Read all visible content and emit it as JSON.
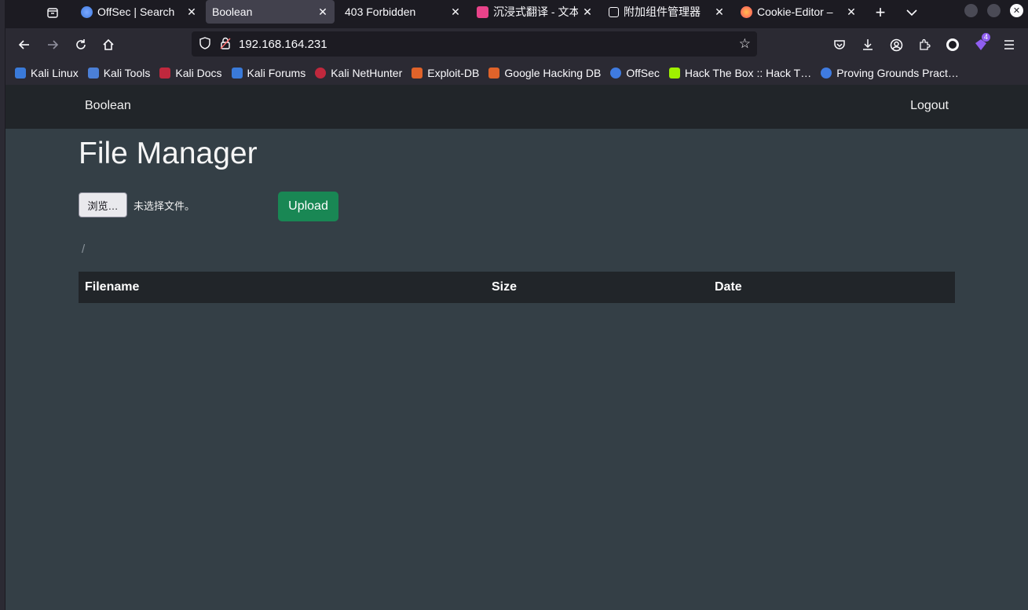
{
  "browser": {
    "tabs": [
      {
        "title": "OffSec | Search",
        "favicon_color": "#3f7be0",
        "active": false
      },
      {
        "title": "Boolean",
        "favicon_color": "",
        "active": true
      },
      {
        "title": "403 Forbidden",
        "favicon_color": "",
        "active": false
      },
      {
        "title": "沉浸式翻译 - 文本",
        "favicon_color": "#e8438a",
        "active": false
      },
      {
        "title": "附加组件管理器",
        "favicon_color": "",
        "active": false
      },
      {
        "title": "Cookie-Editor – ",
        "favicon_color": "#ff7139",
        "active": false
      }
    ],
    "url": "192.168.164.231",
    "extension_badge": "4",
    "bookmarks": [
      {
        "label": "Kali Linux",
        "color": "#3a7ad9"
      },
      {
        "label": "Kali Tools",
        "color": "#4b7fd6"
      },
      {
        "label": "Kali Docs",
        "color": "#c0283d"
      },
      {
        "label": "Kali Forums",
        "color": "#3a7ad9"
      },
      {
        "label": "Kali NetHunter",
        "color": "#c0283d"
      },
      {
        "label": "Exploit-DB",
        "color": "#e0632a"
      },
      {
        "label": "Google Hacking DB",
        "color": "#e0632a"
      },
      {
        "label": "OffSec",
        "color": "#3f7be0"
      },
      {
        "label": "Hack The Box :: Hack T…",
        "color": "#9fef00"
      },
      {
        "label": "Proving Grounds Pract…",
        "color": "#3f7be0"
      }
    ]
  },
  "site": {
    "brand": "Boolean",
    "logout": "Logout",
    "title": "File Manager",
    "file_button": "浏览…",
    "no_file": "未选择文件。",
    "upload": "Upload",
    "breadcrumb": "/",
    "table_headers": [
      "Filename",
      "Size",
      "Date"
    ]
  }
}
